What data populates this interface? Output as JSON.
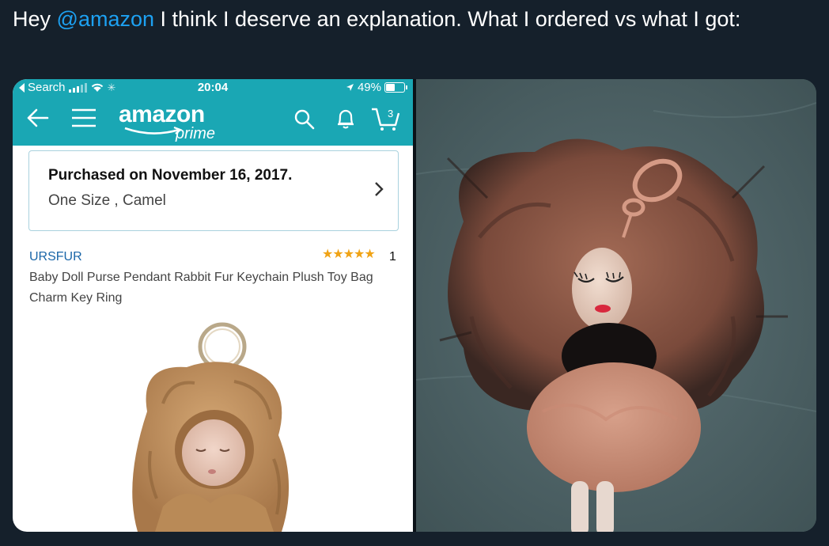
{
  "tweet": {
    "text_before": "Hey ",
    "mention": "@amazon",
    "text_after": " I think I deserve an explanation. What I ordered vs what I got:"
  },
  "statusbar": {
    "back_label": "Search",
    "time": "20:04",
    "battery": "49%"
  },
  "navbar": {
    "logo_word": "amazon",
    "logo_sub": "prime",
    "cart_count": "3"
  },
  "order": {
    "purchased": "Purchased on November 16, 2017.",
    "variant": "One Size , Camel"
  },
  "product": {
    "brand": "URSFUR",
    "stars": "★★★★★",
    "rating_count": "1",
    "title": "Baby Doll Purse Pendant Rabbit Fur Keychain Plush Toy Bag Charm Key Ring"
  },
  "colors": {
    "amazon_teal": "#1aa7b4",
    "link_blue": "#1da1f2",
    "star_orange": "#f0a315"
  }
}
